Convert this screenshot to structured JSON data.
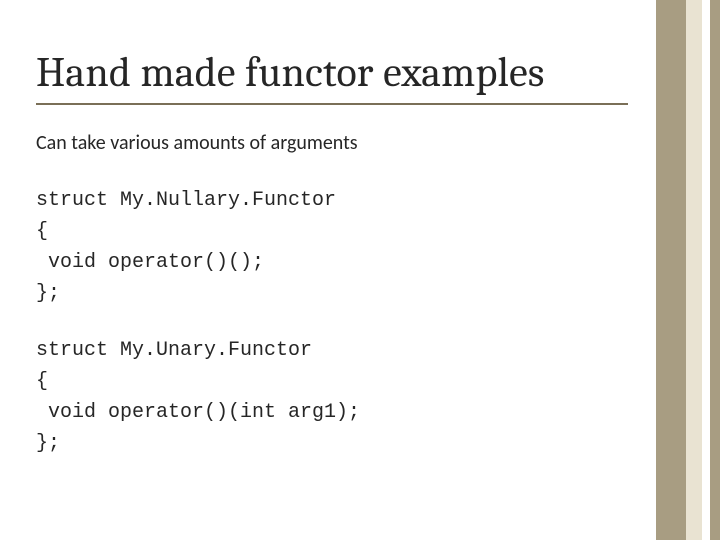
{
  "title": "Hand made functor examples",
  "subtitle": "Can take various amounts of arguments",
  "code1": "struct My.Nullary.Functor\n{\n void operator()();\n};",
  "code2": "struct My.Unary.Functor\n{\n void operator()(int arg1);\n};"
}
